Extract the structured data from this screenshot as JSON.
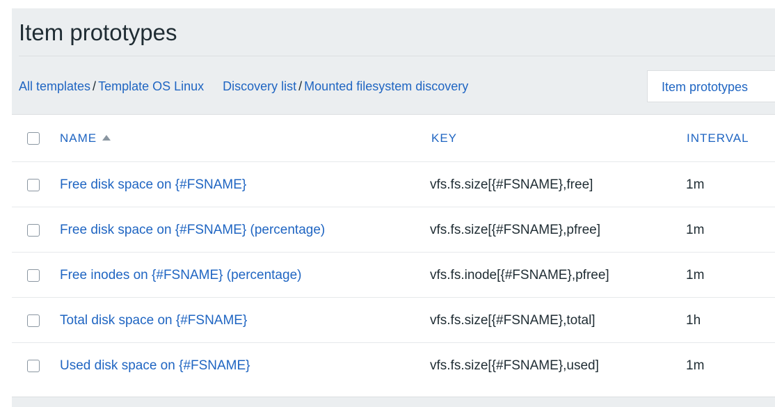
{
  "header": {
    "title": "Item prototypes"
  },
  "breadcrumbs": {
    "all_templates": "All templates",
    "separator": "/",
    "template": "Template OS Linux",
    "discovery_list": "Discovery list",
    "discovery_rule": "Mounted filesystem discovery",
    "active_tab": "Item prototypes"
  },
  "table": {
    "columns": {
      "name": "NAME",
      "key": "KEY",
      "interval": "INTERVAL"
    },
    "sort": {
      "column": "name",
      "direction": "ascending",
      "icon": "sort-ascending-icon"
    },
    "rows": [
      {
        "name": "Free disk space on {#FSNAME}",
        "key": "vfs.fs.size[{#FSNAME},free]",
        "interval": "1m"
      },
      {
        "name": "Free disk space on {#FSNAME} (percentage)",
        "key": "vfs.fs.size[{#FSNAME},pfree]",
        "interval": "1m"
      },
      {
        "name": "Free inodes on {#FSNAME} (percentage)",
        "key": "vfs.fs.inode[{#FSNAME},pfree]",
        "interval": "1m"
      },
      {
        "name": "Total disk space on {#FSNAME}",
        "key": "vfs.fs.size[{#FSNAME},total]",
        "interval": "1h"
      },
      {
        "name": "Used disk space on {#FSNAME}",
        "key": "vfs.fs.size[{#FSNAME},used]",
        "interval": "1m"
      }
    ]
  },
  "colors": {
    "link": "#1f65c2",
    "text": "#1f2c33",
    "panel_background": "#ebeef0",
    "table_background": "#ffffff"
  }
}
